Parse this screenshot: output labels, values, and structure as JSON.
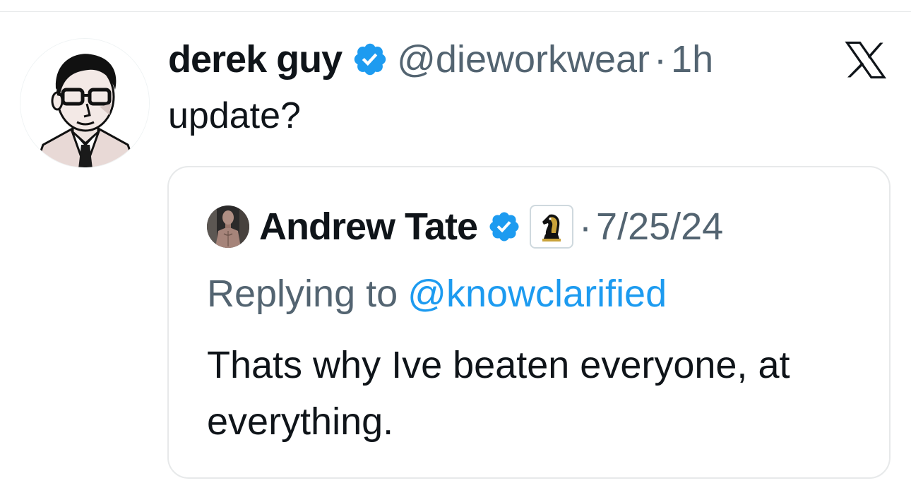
{
  "tweet": {
    "author": {
      "display_name": "derek guy",
      "handle": "@dieworkwear",
      "verified": true,
      "avatar_icon": "illustrated-man-glasses-avatar"
    },
    "separator": "·",
    "timestamp": "1h",
    "text": "update?",
    "platform_icon": "x-logo-icon"
  },
  "quoted_tweet": {
    "author": {
      "display_name": "Andrew Tate",
      "verified": true,
      "avatar_icon": "shirtless-man-avatar",
      "affiliate_badge_icon": "chess-knight-icon"
    },
    "separator": "·",
    "date": "7/25/24",
    "replying_prefix": "Replying to",
    "replying_to": "@knowclarified",
    "text": "Thats why Ive beaten everyone, at everything."
  },
  "colors": {
    "primary_text": "#0f1419",
    "secondary_text": "#536471",
    "link_blue": "#1d9bf0",
    "border": "#e7e9ea",
    "verified_blue": "#1d9bf0"
  }
}
